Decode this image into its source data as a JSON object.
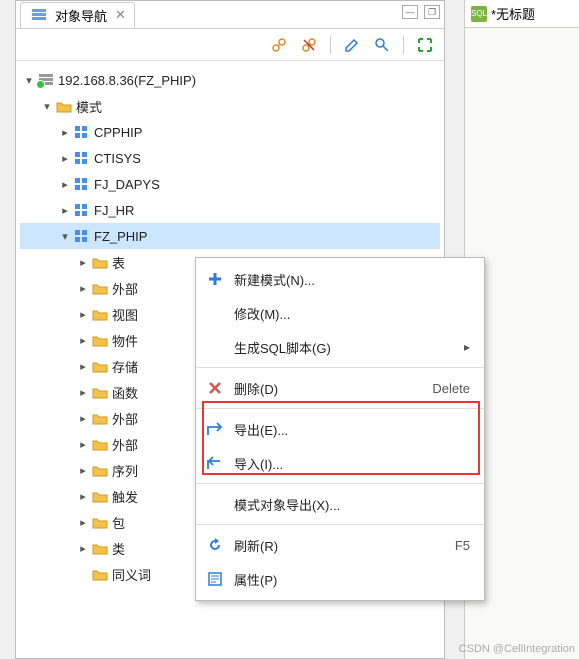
{
  "tab": {
    "title": "对象导航"
  },
  "right_tab": {
    "title": "*无标题",
    "icon_label": "SQL"
  },
  "tree": {
    "root": "192.168.8.36(FZ_PHIP)",
    "mode_label": "模式",
    "schemas": [
      "CPPHIP",
      "CTISYS",
      "FJ_DAPYS",
      "FJ_HR",
      "FZ_PHIP"
    ],
    "subfolders": [
      "表",
      "外部",
      "视图",
      "物件",
      "存储",
      "函数",
      "外部",
      "外部",
      "序列",
      "触发",
      "包",
      "类",
      "同义词"
    ]
  },
  "menu": {
    "new_schema": "新建模式(N)...",
    "modify": "修改(M)...",
    "gen_sql": "生成SQL脚本(G)",
    "delete": "删除(D)",
    "delete_key": "Delete",
    "export": "导出(E)...",
    "import": "导入(I)...",
    "schema_export": "模式对象导出(X)...",
    "refresh": "刷新(R)",
    "refresh_key": "F5",
    "properties": "属性(P)"
  },
  "watermark": "CSDN @CellIntegration"
}
